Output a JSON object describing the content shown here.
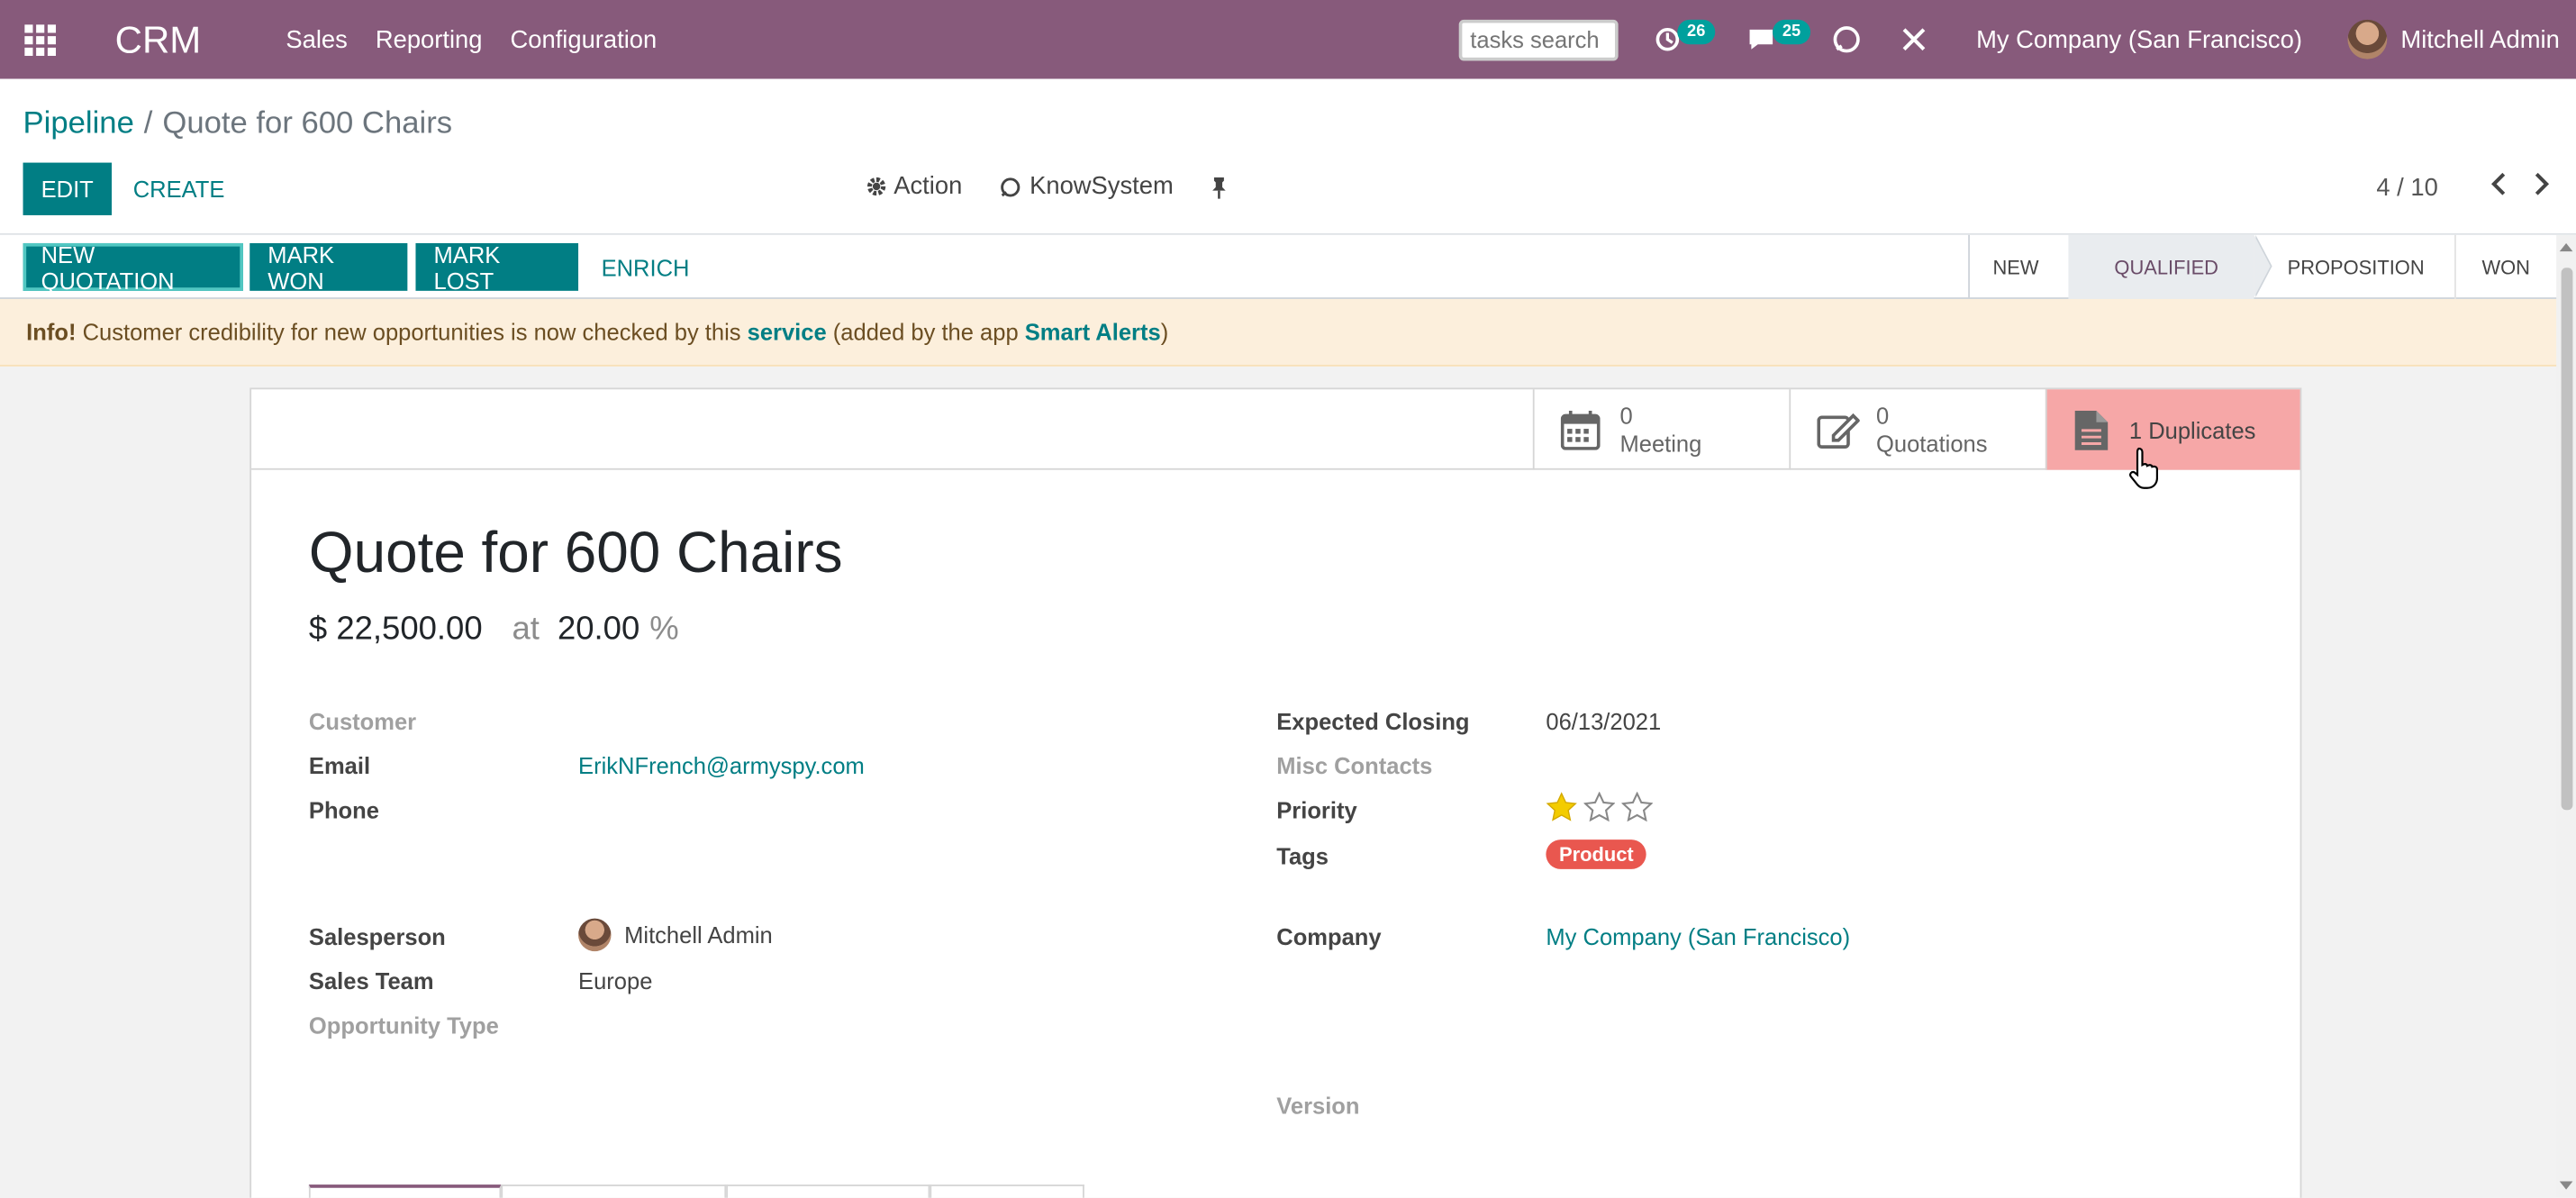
{
  "navbar": {
    "brand": "CRM",
    "menu": [
      "Sales",
      "Reporting",
      "Configuration"
    ],
    "search_placeholder": "tasks search",
    "activity_count": "26",
    "message_count": "25",
    "company": "My Company (San Francisco)",
    "user": "Mitchell Admin",
    "icons": [
      "apps-grid-icon",
      "clock-icon",
      "chat-icon",
      "odoobot-icon",
      "debug-tools-icon"
    ]
  },
  "breadcrumb": {
    "parent": "Pipeline",
    "separator": "/",
    "current": "Quote for 600 Chairs"
  },
  "control": {
    "edit": "Edit",
    "create": "Create",
    "action": "Action",
    "knowsystem": "KnowSystem",
    "pager": "4 / 10"
  },
  "statusbar": {
    "buttons": [
      "New Quotation",
      "Mark Won",
      "Mark Lost",
      "Enrich"
    ],
    "stages": [
      "New",
      "Qualified",
      "Proposition",
      "Won"
    ],
    "active_stage": "Qualified"
  },
  "alert": {
    "prefix": "Info!",
    "text1": " Customer credibility for new opportunities is now checked by this ",
    "link1": "service",
    "text2": " (added by the app ",
    "link2": "Smart Alerts",
    "text3": ")"
  },
  "smart_buttons": {
    "meeting_value": "0",
    "meeting_label": "Meeting",
    "quotations_value": "0",
    "quotations_label": "Quotations",
    "duplicates_label": "1 Duplicates",
    "duplicates_color": "#f6a7a7"
  },
  "record": {
    "name": "Quote for 600 Chairs",
    "revenue": "$ 22,500.00",
    "at": "at",
    "probability": "20.00",
    "pct": "%",
    "left": {
      "customer_label": "Customer",
      "email_label": "Email",
      "email": "ErikNFrench@armyspy.com",
      "phone_label": "Phone",
      "salesperson_label": "Salesperson",
      "salesperson": "Mitchell Admin",
      "team_label": "Sales Team",
      "team": "Europe",
      "type_label": "Opportunity Type"
    },
    "right": {
      "closing_label": "Expected Closing",
      "closing": "06/13/2021",
      "misc_label": "Misc Contacts",
      "priority_label": "Priority",
      "priority_stars": 1,
      "priority_max": 3,
      "tags_label": "Tags",
      "tag": "Product",
      "tag_color": "#e9574f",
      "company_label": "Company",
      "company": "My Company (San Francisco)",
      "version_label": "Version"
    }
  },
  "colors": {
    "navbar": "#875a7b",
    "primary": "#017e84",
    "alert_bg": "#fcefdc"
  }
}
